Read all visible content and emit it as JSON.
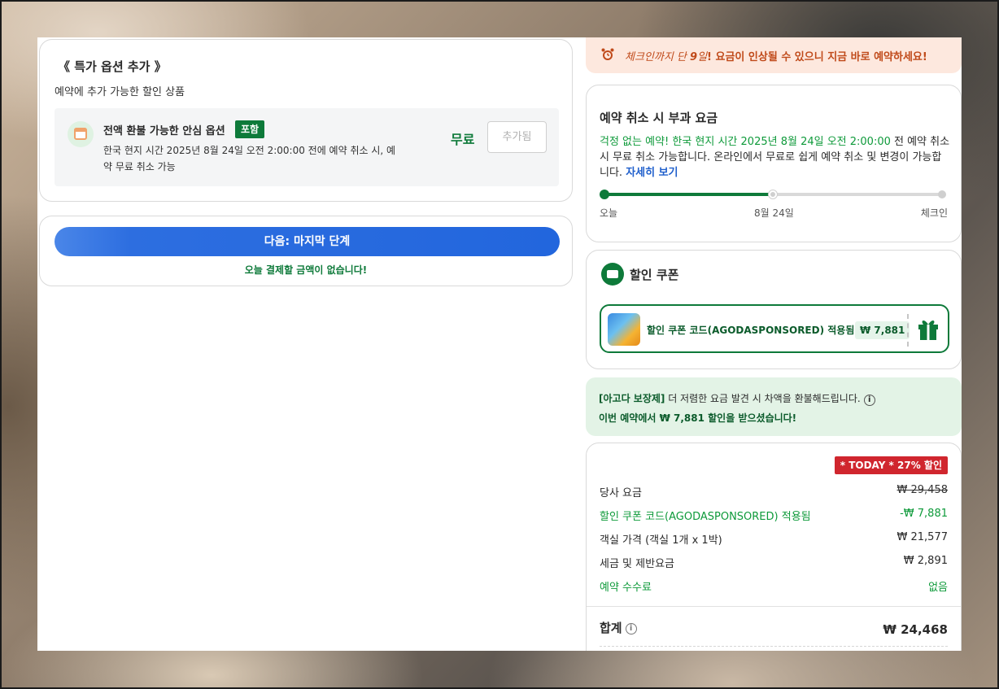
{
  "option": {
    "title": "《 특가 옵션 추가 》",
    "subtitle": "예약에 추가 가능한 할인 상품",
    "name": "전액 환불 가능한 안심 옵션",
    "badge": "포함",
    "desc": "한국 현지 시간 2025년 8월 24일 오전 2:00:00 전에 예약 취소 시, 예약 무료 취소 가능",
    "price": "무료",
    "added_label": "추가됨"
  },
  "next": {
    "button": "다음: 마지막 단계",
    "note": "오늘 결제할 금액이 없습니다!"
  },
  "alert": {
    "pre": "체크인까지 단 ",
    "num": "9",
    "unit": "일",
    "post": "! 요금이 인상될 수 있으니 지금 바로 예약하세요!"
  },
  "cancel": {
    "title": "예약 취소 시 부과 요금",
    "green_text": "걱정 없는 예약! 한국 현지 시간 2025년 8월 24일 오전 2:00:00",
    "text": " 전 예약 취소 시 무료 취소 가능합니다. 온라인에서 무료로 쉽게 예약 취소 및 변경이 가능합니다. ",
    "link": "자세히 보기",
    "timeline": [
      "오늘",
      "8월 24일",
      "체크인"
    ]
  },
  "coupon": {
    "title": "할인 쿠폰",
    "applied": "할인 쿠폰 코드(AGODASPONSORED) 적용됨",
    "amount": "₩ 7,881"
  },
  "guarantee": {
    "bold": "[아고다 보장제]",
    "text": " 더 저렴한 요금 발견 시 차액을 환불해드립니다.",
    "info": "i",
    "savings": "이번 예약에서 ₩ 7,881 할인을 받으셨습니다!"
  },
  "price": {
    "today_badge": "* TODAY * 27% 할인",
    "rows": [
      {
        "label": "당사 요금",
        "value": "₩ 29,458"
      },
      {
        "label": "할인 쿠폰 코드(AGODASPONSORED) 적용됨",
        "value": "-₩ 7,881"
      },
      {
        "label": "객실 가격 (객실 1개 x 1박)",
        "value": "₩ 21,577"
      },
      {
        "label": "세금 및 제반요금",
        "value": "₩ 2,891"
      },
      {
        "label": "예약 수수료",
        "value": "없음"
      }
    ],
    "total_label": "합계",
    "total_info": "i",
    "total_value": "₩ 24,468"
  },
  "colors": {
    "brand_green": "#0e7a3a",
    "primary_blue": "#2266dd",
    "alert_text": "#c04a1a",
    "badge_red": "#d0262e"
  }
}
